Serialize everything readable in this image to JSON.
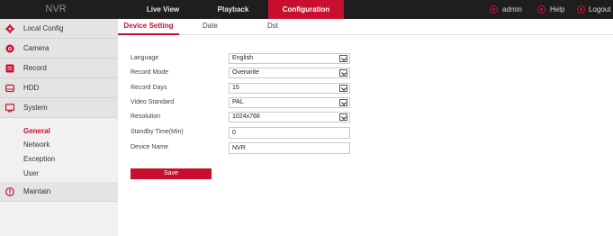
{
  "app": {
    "brand": "NVR"
  },
  "topnav": {
    "tabs": [
      {
        "label": "Live View"
      },
      {
        "label": "Playback"
      },
      {
        "label": "Configuration",
        "active": true
      }
    ],
    "user": {
      "admin_label": "admin",
      "help_label": "Help",
      "logout_label": "Logout"
    }
  },
  "sidebar": {
    "items": [
      {
        "label": "Local Config",
        "icon": "gear-icon"
      },
      {
        "label": "Camera",
        "icon": "camera-icon"
      },
      {
        "label": "Record",
        "icon": "record-icon"
      },
      {
        "label": "HDD",
        "icon": "hdd-icon"
      },
      {
        "label": "System",
        "icon": "monitor-icon",
        "expanded": true
      }
    ],
    "system_sub": [
      {
        "label": "General",
        "active": true
      },
      {
        "label": "Network"
      },
      {
        "label": "Exception"
      },
      {
        "label": "User"
      }
    ],
    "maintain": {
      "label": "Maintain",
      "icon": "info-icon"
    }
  },
  "subtabs": [
    {
      "label": "Device Setting",
      "active": true
    },
    {
      "label": "Date"
    },
    {
      "label": "Dst"
    }
  ],
  "form": {
    "language": {
      "label": "Language",
      "value": "English"
    },
    "record_mode": {
      "label": "Record Mode",
      "value": "Overwrite"
    },
    "record_days": {
      "label": "Record Days",
      "value": "15"
    },
    "video_standard": {
      "label": "Video Standard",
      "value": "PAL"
    },
    "resolution": {
      "label": "Resolution",
      "value": "1024x768"
    },
    "standby_time": {
      "label": "Standby Time(Min)",
      "value": "0"
    },
    "device_name": {
      "label": "Device Name",
      "value": "NVR"
    },
    "save_label": "Save"
  },
  "colors": {
    "accent": "#c8102e",
    "topbar": "#1e1e1e",
    "sidebar": "#f1f1f1"
  }
}
